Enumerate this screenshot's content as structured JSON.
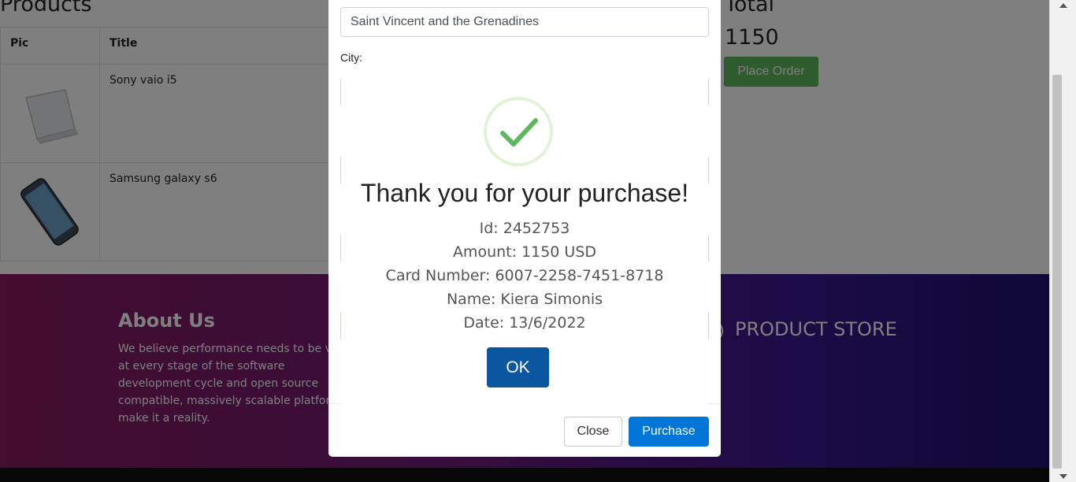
{
  "page": {
    "products_heading": "Products",
    "total_heading": "Total",
    "total_value": "1150",
    "place_order_label": "Place Order",
    "table": {
      "headers": [
        "Pic",
        "Title"
      ],
      "rows": [
        {
          "title": "Sony vaio i5",
          "image": "laptop-image"
        },
        {
          "title": "Samsung galaxy s6",
          "image": "phone-image"
        }
      ]
    }
  },
  "footer": {
    "about_title": "About Us",
    "about_text": "We believe performance needs to be valid at every stage of the software development cycle and open source compatible, massively scalable platforms make it a reality.",
    "store_name": "PRODUCT STORE"
  },
  "modal": {
    "country_value": "Saint Vincent and the Grenadines",
    "city_label": "City:",
    "close_label": "Close",
    "purchase_label": "Purchase"
  },
  "alert": {
    "icon": "success-check-icon",
    "title": "Thank you for your purchase!",
    "id_line": "Id: 2452753",
    "amount_line": "Amount: 1150 USD",
    "card_line": "Card Number: 6007-2258-7451-8718",
    "name_line": "Name: Kiera Simonis",
    "date_line": "Date: 13/6/2022",
    "ok_label": "OK",
    "check_color": "#5cb85c"
  }
}
